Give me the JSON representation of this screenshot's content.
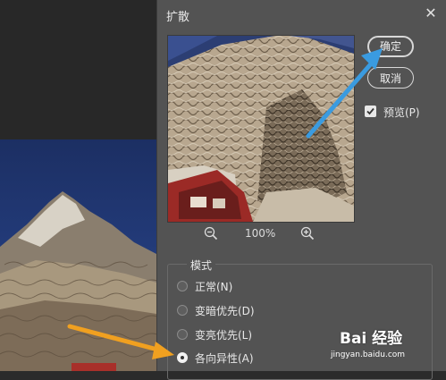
{
  "dialog": {
    "title": "扩散",
    "close_icon": "close-icon",
    "ok_label": "确定",
    "cancel_label": "取消",
    "preview_label": "预览(P)",
    "preview_checked": true,
    "zoom_level": "100%",
    "mode": {
      "title": "模式",
      "options": [
        {
          "label": "正常(N)",
          "checked": false
        },
        {
          "label": "变暗优先(D)",
          "checked": false
        },
        {
          "label": "变亮优先(L)",
          "checked": false
        },
        {
          "label": "各向异性(A)",
          "checked": true
        }
      ]
    }
  },
  "watermark": {
    "logo": "Bai 经验",
    "url": "jingyan.baidu.com"
  },
  "colors": {
    "dialog_bg": "#535353",
    "arrow_blue": "#3a9be0",
    "arrow_orange": "#f0a020"
  }
}
